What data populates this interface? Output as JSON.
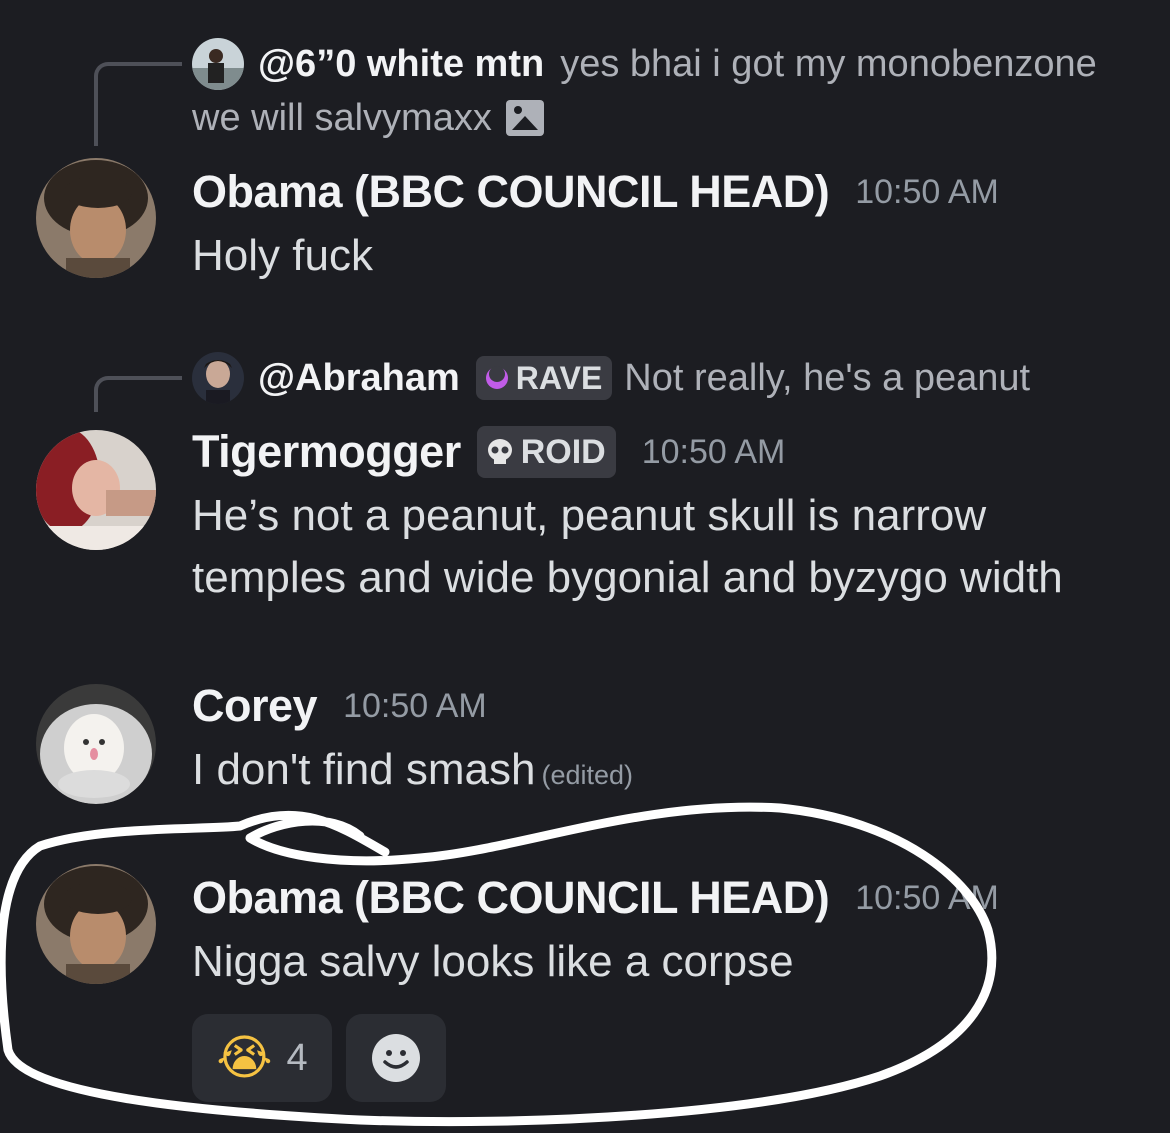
{
  "messages": [
    {
      "reply": {
        "author": "@6”0 white mtn",
        "text_line1": "yes bhai i got my monobenzone",
        "text_line2": "we will salvymaxx",
        "attachment_icon": "image-icon"
      },
      "author": "Obama (BBC COUNCIL HEAD)",
      "timestamp": "10:50 AM",
      "text": "Holy fuck"
    },
    {
      "reply": {
        "author": "@Abraham",
        "tag": "RAVE",
        "tag_icon": "crescent-moon-icon",
        "text": "Not really, he's a peanut"
      },
      "author": "Tigermogger",
      "tag": "ROID",
      "tag_icon": "skull-icon",
      "timestamp": "10:50 AM",
      "text_line1": "He’s not a peanut, peanut skull is narrow",
      "text_line2": "temples and wide bygonial and byzygo width"
    },
    {
      "author": "Corey",
      "timestamp": "10:50 AM",
      "text": "I don't find smash",
      "edited_label": "(edited)"
    },
    {
      "author": "Obama (BBC COUNCIL HEAD)",
      "timestamp": "10:50 AM",
      "text": "Nigga salvy looks like a corpse",
      "reactions": [
        {
          "emoji": "😭",
          "count": "4"
        },
        {
          "emoji": "add-reaction-icon"
        }
      ]
    }
  ],
  "colors": {
    "background": "#1c1d22",
    "username": "#f2f3f5",
    "timestamp": "#949ba4",
    "annotation": "#ffffff"
  }
}
